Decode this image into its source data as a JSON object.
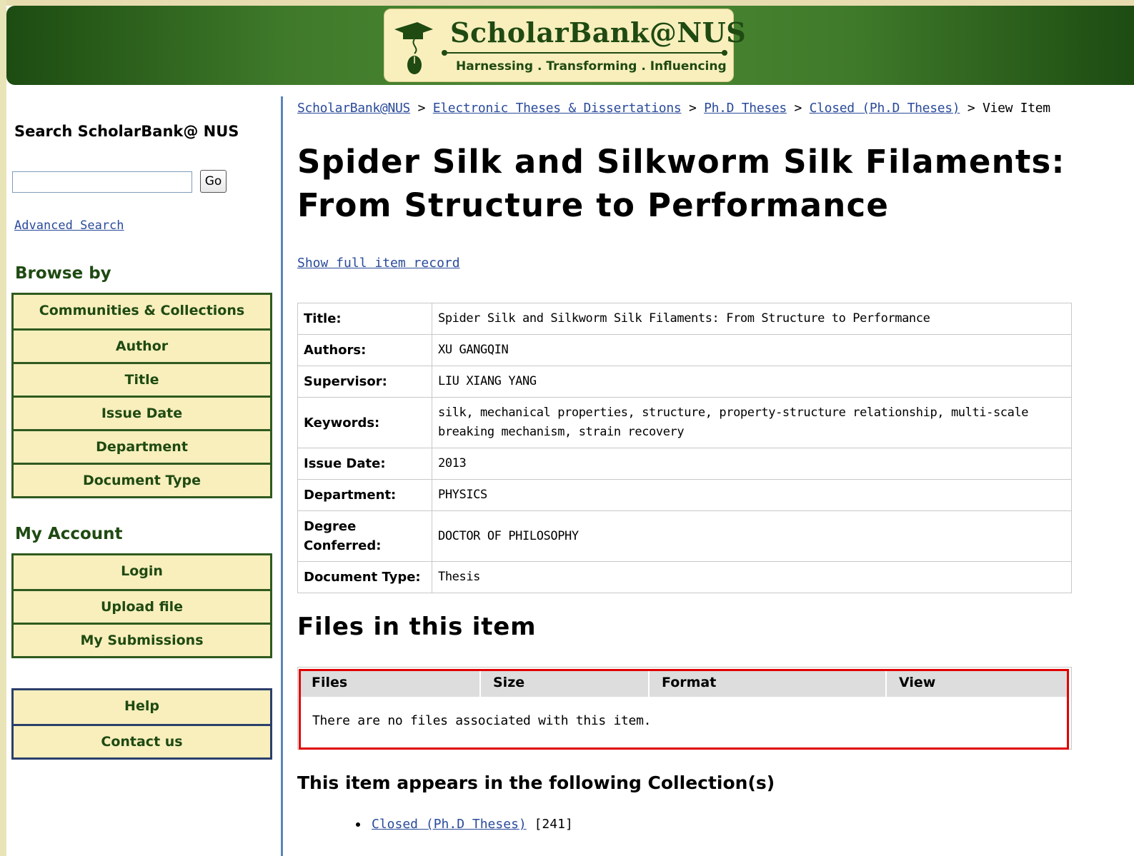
{
  "header": {
    "logo_title": "ScholarBank@NUS",
    "logo_tagline": "Harnessing . Transforming . Influencing"
  },
  "sidebar": {
    "search_title": "Search ScholarBank@ NUS",
    "search_placeholder": "",
    "go_label": "Go",
    "advanced_search": "Advanced Search",
    "browse_heading": "Browse by",
    "browse_items": [
      {
        "label": "Communities & Collections"
      },
      {
        "label": "Author"
      },
      {
        "label": "Title"
      },
      {
        "label": "Issue Date"
      },
      {
        "label": "Department"
      },
      {
        "label": "Document Type"
      }
    ],
    "account_heading": "My Account",
    "account_items": [
      {
        "label": "Login"
      },
      {
        "label": "Upload file"
      },
      {
        "label": "My Submissions"
      }
    ],
    "help_items": [
      {
        "label": "Help"
      },
      {
        "label": "Contact us"
      }
    ]
  },
  "breadcrumb": {
    "items": [
      "ScholarBank@NUS",
      "Electronic Theses & Dissertations",
      "Ph.D Theses",
      "Closed (Ph.D Theses)"
    ],
    "separator": ">",
    "current": "View Item"
  },
  "item": {
    "title": "Spider Silk and Silkworm Silk Filaments: From Structure to Performance",
    "show_full": "Show full item record",
    "fields": [
      {
        "label": "Title:",
        "value": "Spider Silk and Silkworm Silk Filaments: From Structure to Performance"
      },
      {
        "label": "Authors:",
        "value": "XU GANGQIN"
      },
      {
        "label": "Supervisor:",
        "value": "LIU XIANG YANG"
      },
      {
        "label": "Keywords:",
        "value": "silk, mechanical properties, structure, property-structure relationship, multi-scale breaking mechanism, strain recovery"
      },
      {
        "label": "Issue Date:",
        "value": "2013"
      },
      {
        "label": "Department:",
        "value": "PHYSICS"
      },
      {
        "label": "Degree Conferred:",
        "value": "DOCTOR OF PHILOSOPHY"
      },
      {
        "label": "Document Type:",
        "value": "Thesis"
      }
    ]
  },
  "files": {
    "heading": "Files in this item",
    "columns": [
      "Files",
      "Size",
      "Format",
      "View"
    ],
    "empty_message": "There are no files associated with this item.",
    "highlight_color": "#e00000"
  },
  "collections": {
    "heading": "This item appears in the following Collection(s)",
    "items": [
      {
        "name": "Closed (Ph.D Theses)",
        "count": "[241]"
      }
    ]
  }
}
